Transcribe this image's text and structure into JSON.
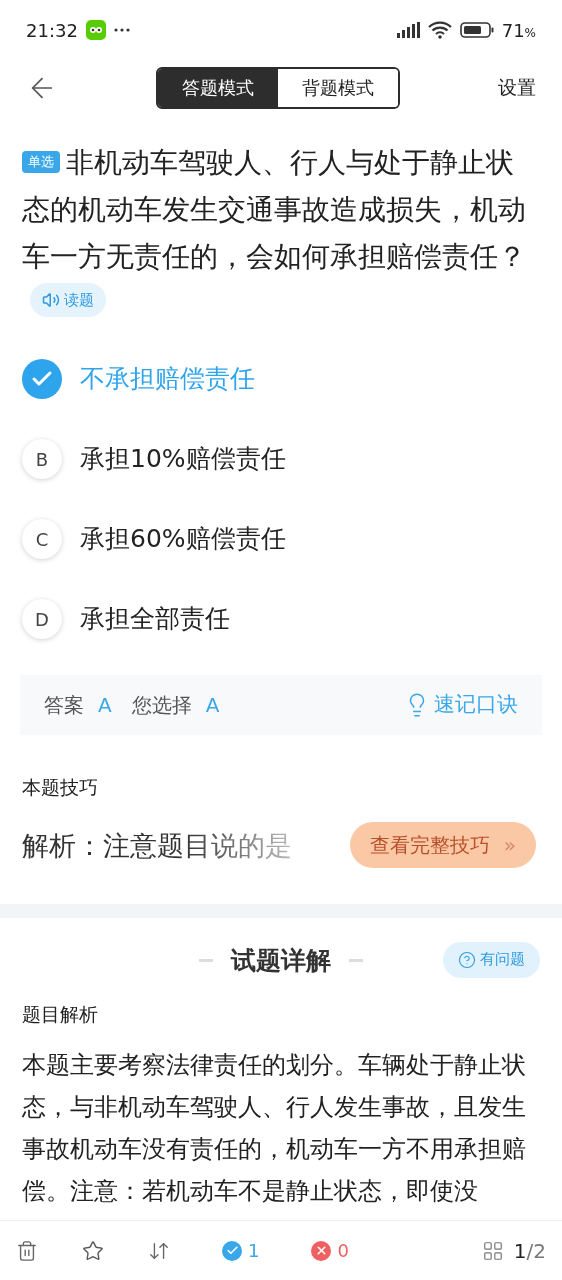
{
  "status_bar": {
    "time": "21:32",
    "battery": "71",
    "battery_unit": "%"
  },
  "header": {
    "modes": [
      {
        "label": "答题模式",
        "selected": true
      },
      {
        "label": "背题模式",
        "selected": false
      }
    ],
    "settings": "设置"
  },
  "question": {
    "type_tag": "单选",
    "text": "非机动车驾驶人、行人与处于静止状态的机动车发生交通事故造成损失，机动车一方无责任的，会如何承担赔偿责任？",
    "read_button": "读题"
  },
  "options": [
    {
      "text": "不承担赔偿责任",
      "selected": true
    },
    {
      "letter": "B",
      "text": "承担10%赔偿责任",
      "selected": false
    },
    {
      "letter": "C",
      "text": "承担60%赔偿责任",
      "selected": false
    },
    {
      "letter": "D",
      "text": "承担全部责任",
      "selected": false
    }
  ],
  "answer_box": {
    "answer_label": "答案",
    "answer": "A",
    "choice_label": "您选择",
    "choice": "A",
    "mnemonic_button": "速记口诀"
  },
  "tips": {
    "title": "本题技巧",
    "preview": "解析：注意题目说的是",
    "button": "查看完整技巧",
    "button_arrow": "»"
  },
  "explanation": {
    "title": "试题详解",
    "report_button": "有问题",
    "subtitle": "题目解析",
    "text": "本题主要考察法律责任的划分。车辆处于静止状态，与非机动车驾驶人、行人发生事故，且发生事故机动车没有责任的，机动车一方不用承担赔偿。注意：若机动车不是静止状态，即使没"
  },
  "bottom_bar": {
    "correct_count": "1",
    "wrong_count": "0",
    "page_current": "1",
    "page_total": "/2"
  }
}
